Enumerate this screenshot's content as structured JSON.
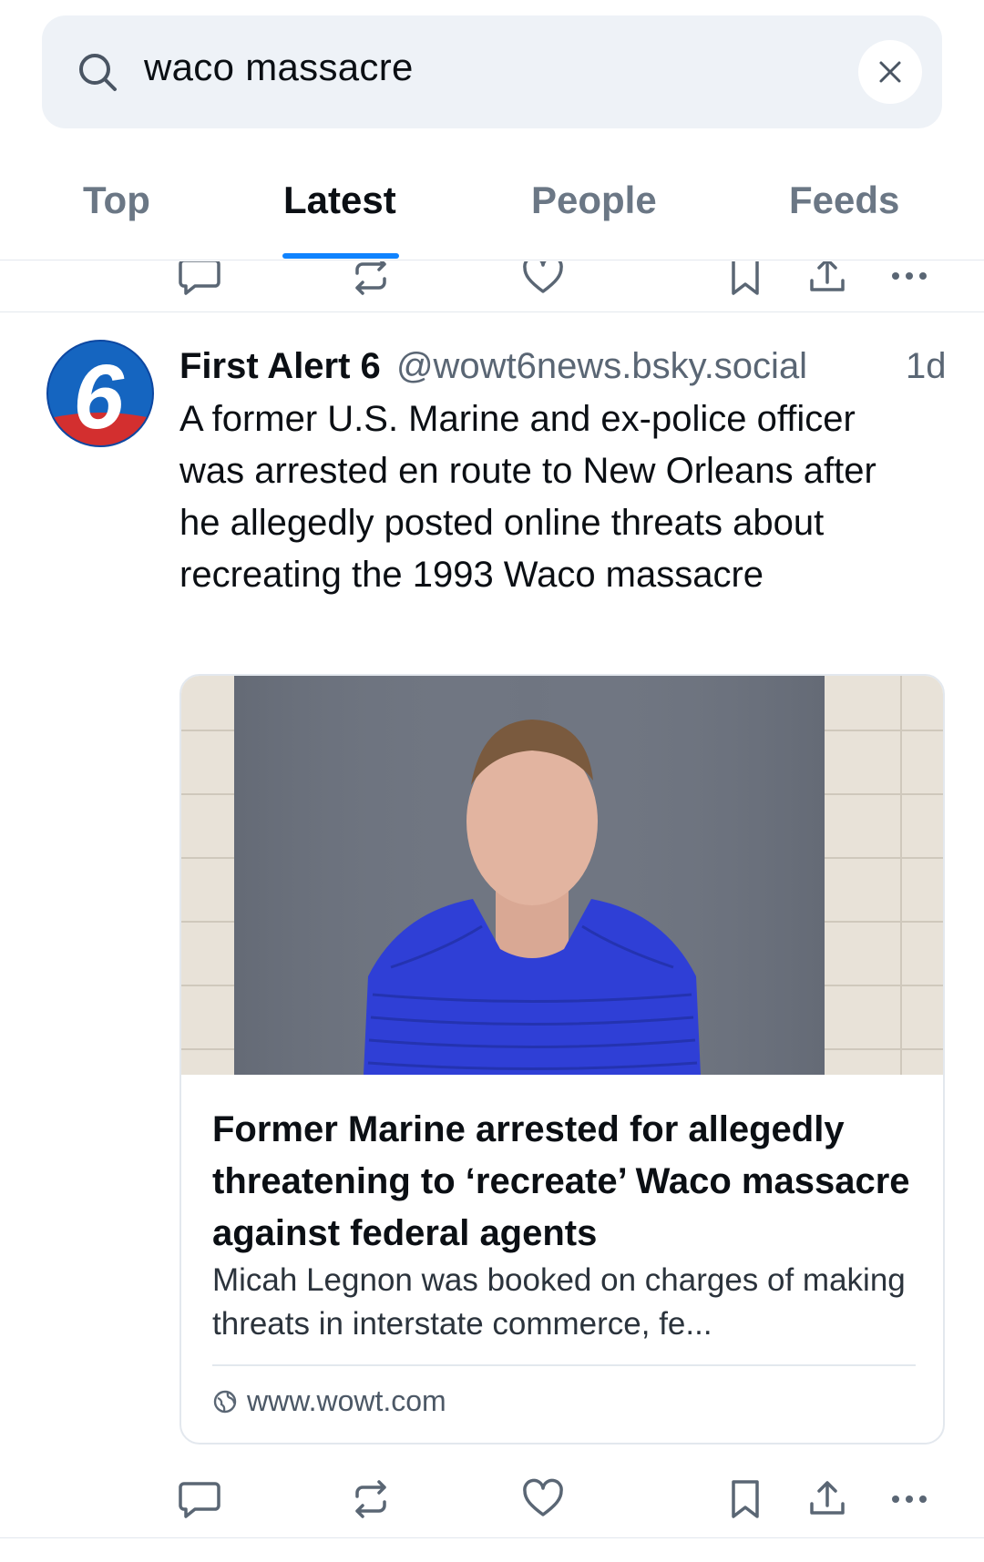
{
  "search": {
    "query": "waco massacre",
    "icon": "search-icon",
    "clear_icon": "close-icon"
  },
  "tabs": [
    {
      "label": "Top",
      "active": false
    },
    {
      "label": "Latest",
      "active": true
    },
    {
      "label": "People",
      "active": false
    },
    {
      "label": "Feeds",
      "active": false
    }
  ],
  "colors": {
    "accent": "#1083fe",
    "muted_text": "#5a6674",
    "search_bg": "#eef2f7",
    "divider": "#e3e8ee"
  },
  "post": {
    "author_name": "First Alert 6",
    "author_handle": "@wowt6news.bsky.social",
    "time": "1d",
    "avatar_icon": "channel-6-logo",
    "text": "A former U.S. Marine and ex-police officer was arrested en route to New Orleans after he allegedly posted online threats about recreating the 1993 Waco massacre",
    "embed": {
      "title": "Former Marine arrested for allegedly threatening to ‘recreate’ Waco massacre against federal agents",
      "description": "Micah Legnon was booked on charges of making threats in interstate commerce, fe...",
      "domain": "www.wowt.com",
      "domain_icon": "globe-icon"
    },
    "actions": [
      "reply-icon",
      "repost-icon",
      "like-icon",
      "bookmark-icon",
      "share-icon",
      "more-icon"
    ]
  }
}
